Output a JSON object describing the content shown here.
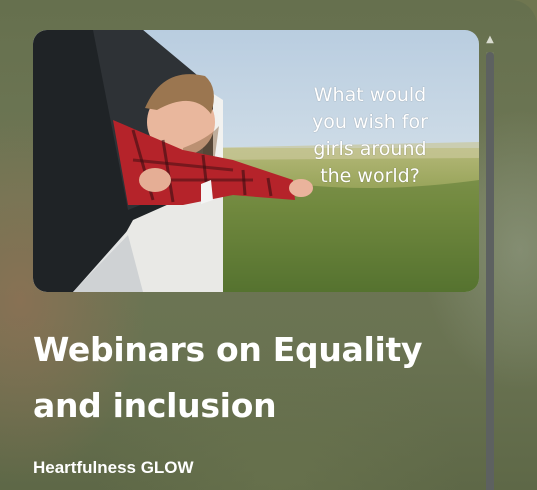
{
  "video": {
    "thumbnail_overlay_lines": [
      "What would",
      "you wish for",
      "girls around",
      "the world?"
    ],
    "title": "Webinars on Equality and inclusion",
    "channel": "Heartfulness GLOW"
  },
  "scrollbar": {
    "up_arrow_icon": "chevron-up-icon",
    "position_fraction": 0.0
  },
  "colors": {
    "panel_bg": "#6e7755",
    "text": "#ffffff",
    "scroll_thumb": "#5d6160"
  }
}
